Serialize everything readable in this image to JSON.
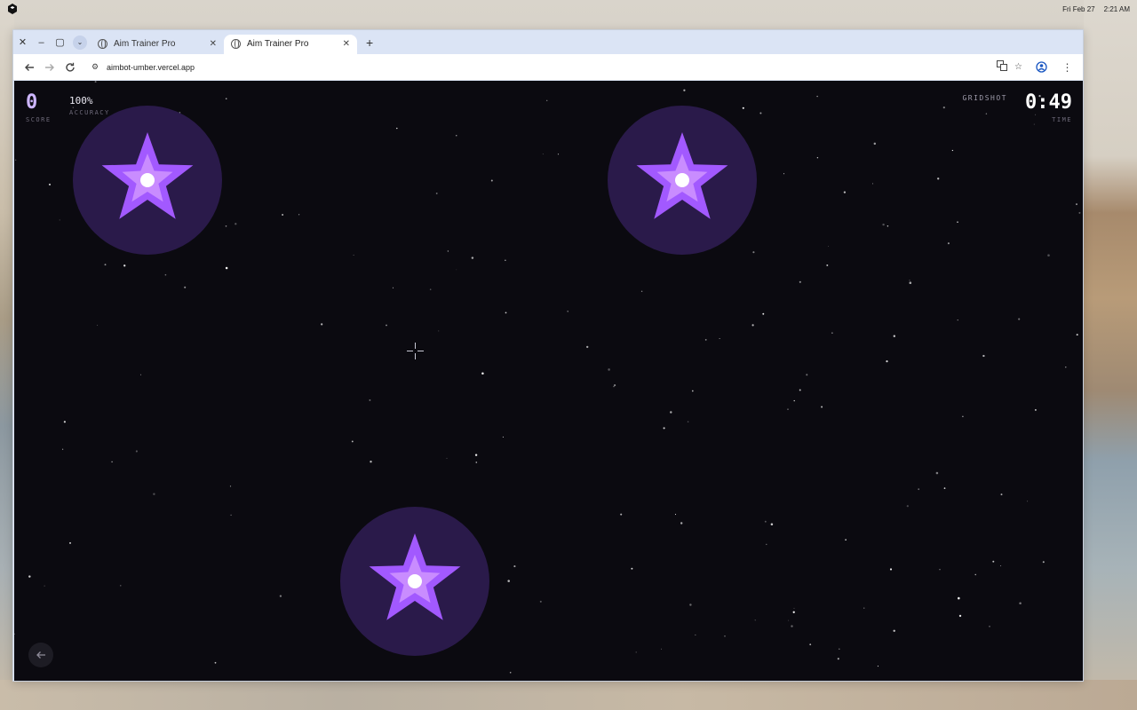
{
  "system": {
    "date": "Fri Feb 27",
    "time": "2:21 AM"
  },
  "browser": {
    "tabs": [
      {
        "title": "Aim Trainer Pro",
        "active": false
      },
      {
        "title": "Aim Trainer Pro",
        "active": true
      }
    ],
    "url": "aimbot-umber.vercel.app",
    "icons": {
      "close": "close-icon",
      "minimize": "minimize-icon",
      "maximize": "maximize-icon",
      "tab_search": "chevron-down-icon",
      "new_tab": "plus-icon",
      "back": "arrow-left-icon",
      "forward": "arrow-right-icon",
      "reload": "reload-icon",
      "site_info": "tune-icon",
      "translate": "translate-icon",
      "bookmark": "star-outline-icon",
      "profile": "account-icon",
      "menu": "kebab-menu-icon"
    }
  },
  "game": {
    "score": "0",
    "score_label": "SCORE",
    "accuracy": "100%",
    "accuracy_label": "ACCURACY",
    "mode": "GRIDSHOT",
    "time": "0:49",
    "time_label": "TIME",
    "targets": [
      {
        "name": "target-top-left"
      },
      {
        "name": "target-top-right"
      },
      {
        "name": "target-bottom-center"
      }
    ],
    "colors": {
      "background": "#0b0a10",
      "target_ring": "#2a1a4a",
      "star_outer": "#a259ff",
      "star_inner": "#c98cff",
      "score_accent": "#cdb6ff"
    },
    "back_icon": "arrow-left-icon"
  }
}
